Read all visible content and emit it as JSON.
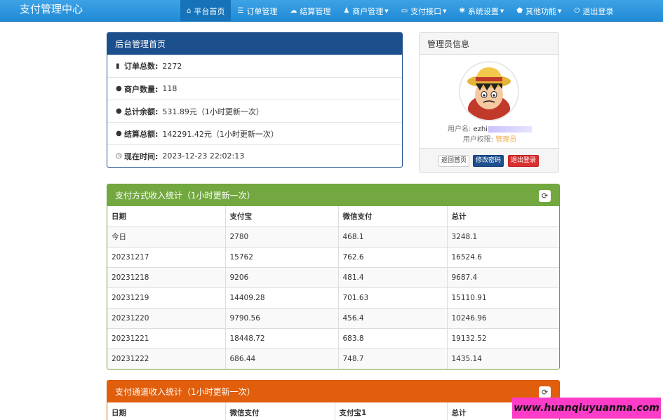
{
  "brand": "支付管理中心",
  "nav": [
    {
      "icon": "home-icon",
      "glyph": "⌂",
      "label": "平台首页",
      "caret": false,
      "active": true
    },
    {
      "icon": "list-icon",
      "glyph": "☰",
      "label": "订单管理",
      "caret": false,
      "active": false
    },
    {
      "icon": "cloud-icon",
      "glyph": "☁",
      "label": "结算管理",
      "caret": false,
      "active": false
    },
    {
      "icon": "user-icon",
      "glyph": "♟",
      "label": "商户管理",
      "caret": true,
      "active": false
    },
    {
      "icon": "card-icon",
      "glyph": "▭",
      "label": "支付接口",
      "caret": true,
      "active": false
    },
    {
      "icon": "gear-icon",
      "glyph": "✱",
      "label": "系统设置",
      "caret": true,
      "active": false
    },
    {
      "icon": "shield-icon",
      "glyph": "⬟",
      "label": "其他功能",
      "caret": true,
      "active": false
    },
    {
      "icon": "power-icon",
      "glyph": "⏻",
      "label": "退出登录",
      "caret": false,
      "active": false
    }
  ],
  "home": {
    "title": "后台管理首页",
    "stats": [
      {
        "icon": "bar-chart-icon",
        "glyph": "▮",
        "label": "订单总数:",
        "value": "2272"
      },
      {
        "icon": "drop-icon",
        "glyph": "●",
        "label": "商户数量:",
        "value": "118"
      },
      {
        "icon": "drop-icon",
        "glyph": "●",
        "label": "总计余额:",
        "value": "531.89元（1小时更新一次）"
      },
      {
        "icon": "drop-icon",
        "glyph": "●",
        "label": "结算总额:",
        "value": "142291.42元（1小时更新一次）"
      },
      {
        "icon": "clock-icon",
        "glyph": "◷",
        "label": "现在时间:",
        "value": "2023-12-23 22:02:13"
      }
    ]
  },
  "admin": {
    "title": "管理员信息",
    "username_label": "用户名:",
    "username": "ezhi",
    "role_label": "用户权限:",
    "role": "管理员",
    "buttons": {
      "home": "返回首页",
      "password": "修改密码",
      "logout": "退出登录"
    }
  },
  "pay_stats": {
    "title": "支付方式收入统计（1小时更新一次）",
    "headers": [
      "日期",
      "支付宝",
      "微信支付",
      "总计"
    ],
    "rows": [
      [
        "今日",
        "2780",
        "468.1",
        "3248.1"
      ],
      [
        "20231217",
        "15762",
        "762.6",
        "16524.6"
      ],
      [
        "20231218",
        "9206",
        "481.4",
        "9687.4"
      ],
      [
        "20231219",
        "14409.28",
        "701.63",
        "15110.91"
      ],
      [
        "20231220",
        "9790.56",
        "456.4",
        "10246.96"
      ],
      [
        "20231221",
        "18448.72",
        "683.8",
        "19132.52"
      ],
      [
        "20231222",
        "686.44",
        "748.7",
        "1435.14"
      ]
    ]
  },
  "channel_stats": {
    "title": "支付通道收入统计（1小时更新一次）",
    "headers": [
      "日期",
      "微信支付",
      "支付宝1",
      "总计"
    ]
  },
  "watermark": "www.huanqiuyuanma.com"
}
